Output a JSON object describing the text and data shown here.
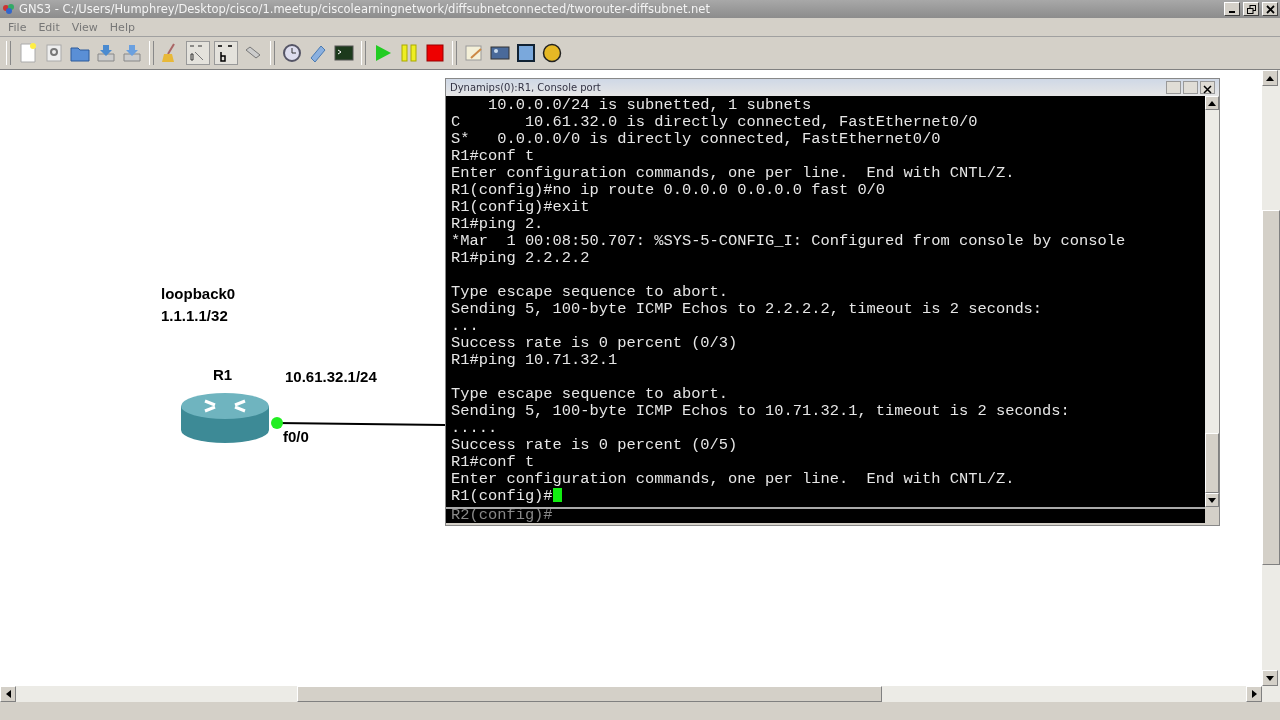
{
  "window": {
    "title": "GNS3 - C:/Users/Humphrey/Desktop/cisco/1.meetup/ciscolearningnetwork/diffsubnetconnected/tworouter-diffsubnet.net"
  },
  "menu": [
    "File",
    "Edit",
    "View",
    "Help"
  ],
  "topology": {
    "loopback_label": "loopback0",
    "loopback_address": "1.1.1.1/32",
    "node_name": "R1",
    "link_address": "10.61.32.1/24",
    "interface": "f0/0"
  },
  "console": {
    "title": "Dynamips(0):R1, Console port",
    "blocks": [
      [
        "    10.0.0.0/24 is subnetted, 1 subnets",
        "C       10.61.32.0 is directly connected, FastEthernet0/0",
        "S*   0.0.0.0/0 is directly connected, FastEthernet0/0",
        "R1#conf t",
        "Enter configuration commands, one per line.  End with CNTL/Z.",
        "R1(config)#no ip route 0.0.0.0 0.0.0.0 fast 0/0",
        "R1(config)#exit",
        "R1#ping 2.",
        "*Mar  1 00:08:50.707: %SYS-5-CONFIG_I: Configured from console by console",
        "R1#ping 2.2.2.2"
      ],
      [
        "Type escape sequence to abort.",
        "Sending 5, 100-byte ICMP Echos to 2.2.2.2, timeout is 2 seconds:",
        "...",
        "Success rate is 0 percent (0/3)",
        "R1#ping 10.71.32.1"
      ],
      [
        "Type escape sequence to abort.",
        "Sending 5, 100-byte ICMP Echos to 10.71.32.1, timeout is 2 seconds:",
        ".....",
        "Success rate is 0 percent (0/5)",
        "R1#conf t",
        "Enter configuration commands, one per line.  End with CNTL/Z."
      ]
    ],
    "prompt": "R1(config)#",
    "cursor": true,
    "behind_prompt": "R2(config)#"
  }
}
